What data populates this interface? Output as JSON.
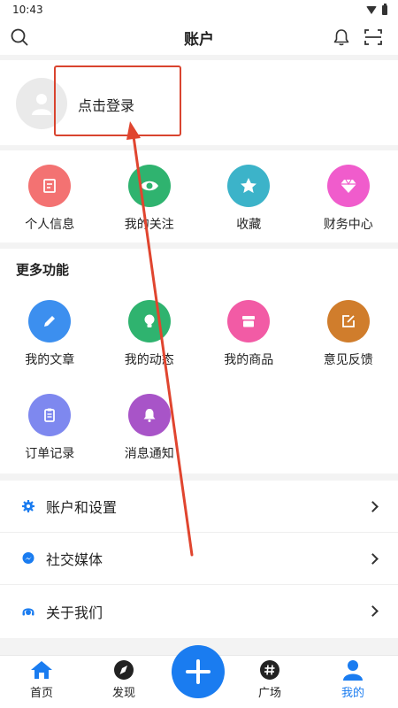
{
  "status_bar": {
    "time": "10:43"
  },
  "header": {
    "title": "账户"
  },
  "profile": {
    "login_text": "点击登录"
  },
  "quick_actions": [
    {
      "label": "个人信息",
      "icon": "note-icon",
      "color": "#f37272"
    },
    {
      "label": "我的关注",
      "icon": "eye-icon",
      "color": "#2fb36f"
    },
    {
      "label": "收藏",
      "icon": "star-icon",
      "color": "#3cb3c9"
    },
    {
      "label": "财务中心",
      "icon": "diamond-icon",
      "color": "#f05ccc"
    }
  ],
  "more_functions": {
    "title": "更多功能",
    "items": [
      {
        "label": "我的文章",
        "icon": "pencil-icon",
        "color": "#3c8fef"
      },
      {
        "label": "我的动态",
        "icon": "bulb-icon",
        "color": "#2fb36f"
      },
      {
        "label": "我的商品",
        "icon": "store-icon",
        "color": "#f25ba5"
      },
      {
        "label": "意见反馈",
        "icon": "edit-icon",
        "color": "#d07d2c"
      },
      {
        "label": "订单记录",
        "icon": "clipboard-icon",
        "color": "#7e88ef"
      },
      {
        "label": "消息通知",
        "icon": "bell-icon",
        "color": "#a854c8"
      }
    ]
  },
  "menu": [
    {
      "label": "账户和设置",
      "icon": "gear-icon"
    },
    {
      "label": "社交媒体",
      "icon": "messenger-icon"
    },
    {
      "label": "关于我们",
      "icon": "support-icon"
    }
  ],
  "tabbar": {
    "tabs": [
      {
        "label": "首页",
        "icon": "home-icon"
      },
      {
        "label": "发现",
        "icon": "compass-icon"
      },
      {
        "label": "广场",
        "icon": "hashtag-icon"
      },
      {
        "label": "我的",
        "icon": "user-icon"
      }
    ],
    "active_index": 3,
    "active_color": "#1a7cf0"
  }
}
